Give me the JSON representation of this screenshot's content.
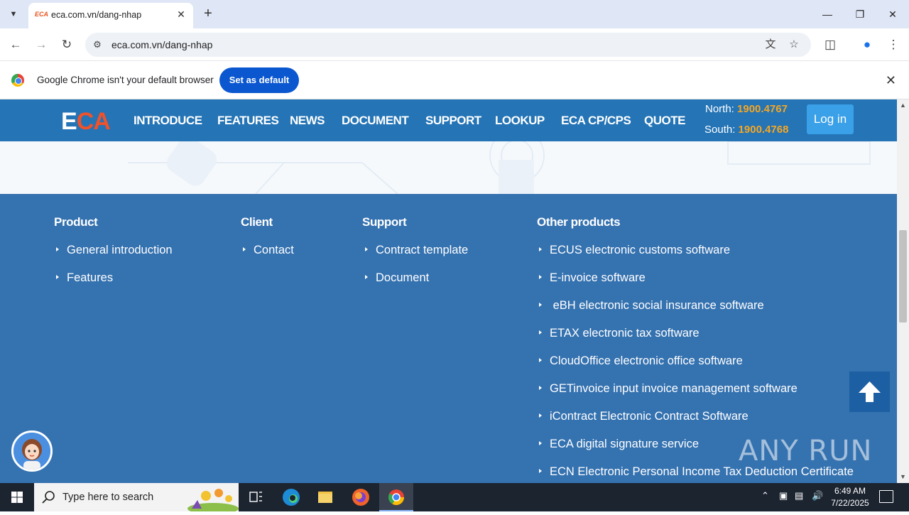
{
  "browser": {
    "tab_title": "eca.com.vn/dang-nhap",
    "tab_favicon_text": "ECA",
    "url": "eca.com.vn/dang-nhap"
  },
  "infobar": {
    "message": "Google Chrome isn't your default browser",
    "button": "Set as default"
  },
  "site": {
    "logo_e": "E",
    "logo_ca": "CA",
    "nav": [
      "INTRODUCE",
      "FEATURES",
      "NEWS",
      "DOCUMENT",
      "SUPPORT",
      "LOOKUP",
      "ECA CP/CPS",
      "QUOTE"
    ],
    "hotline_north_label": "North:",
    "hotline_north": "1900.4767",
    "hotline_south_label": "South:",
    "hotline_south": "1900.4768",
    "login": "Log in"
  },
  "footer": {
    "product": {
      "heading": "Product",
      "links": [
        "General introduction",
        "Features"
      ]
    },
    "client": {
      "heading": "Client",
      "links": [
        "Contact"
      ]
    },
    "support": {
      "heading": "Support",
      "links": [
        "Contract template",
        "Document"
      ]
    },
    "other": {
      "heading": "Other products",
      "links": [
        "ECUS electronic customs software",
        "E-invoice software",
        " eBH electronic social insurance software",
        "ETAX electronic tax software",
        "CloudOffice electronic office software",
        "GETinvoice input invoice management software",
        "iContract Electronic Contract Software",
        "ECA digital signature service",
        "ECN Electronic Personal Income Tax Deduction Certificate"
      ]
    }
  },
  "watermark": "ANY RUN",
  "taskbar": {
    "search_placeholder": "Type here to search",
    "time": "6:49 AM",
    "date": "7/22/2025"
  },
  "colors": {
    "nav_bg": "#2474b6",
    "footer_bg": "#3572b0",
    "accent_orange": "#f5a623",
    "logo_red": "#f0522a",
    "login_bg": "#3aa0e8"
  }
}
